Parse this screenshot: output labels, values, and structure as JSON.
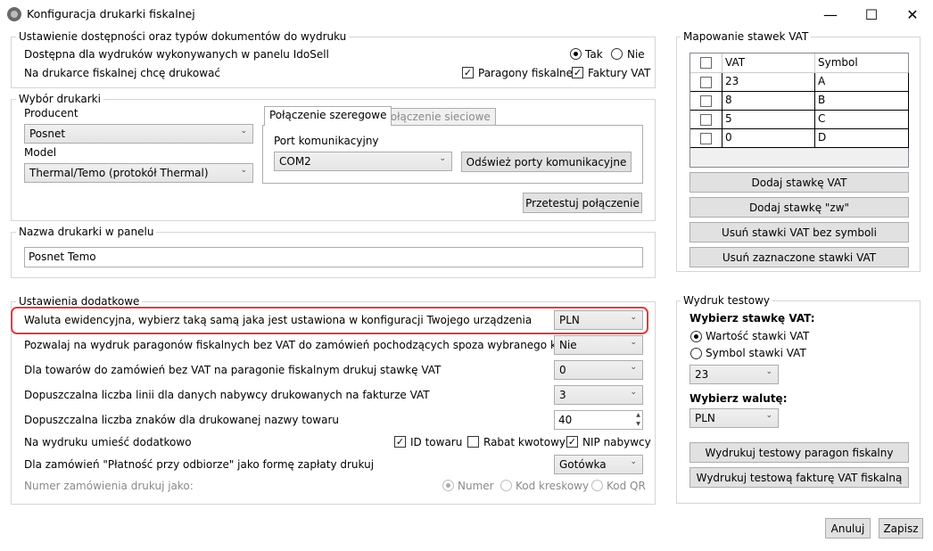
{
  "window": {
    "title": "Konfiguracja drukarki fiskalnej",
    "minimize": "—",
    "maximize": "☐",
    "close": "✕"
  },
  "availability": {
    "legend": "Ustawienie dostępności oraz typów dokumentów do wydruku",
    "available_label": "Dostępna dla wydruków wykonywanych w panelu IdoSell",
    "yes": "Tak",
    "no": "Nie",
    "print_label": "Na drukarce fiskalnej chcę drukować",
    "receipts": "Paragony fiskalne",
    "invoices": "Faktury VAT"
  },
  "printer": {
    "legend": "Wybór drukarki",
    "producer_label": "Producent",
    "producer_value": "Posnet",
    "model_label": "Model",
    "model_value": "Thermal/Temo (protokół Thermal)",
    "tab_serial": "Połączenie szeregowe",
    "tab_network": "Połączenie sieciowe",
    "port_label": "Port komunikacyjny",
    "port_value": "COM2",
    "refresh_ports": "Odśwież porty komunikacyjne",
    "test_connection": "Przetestuj połączenie"
  },
  "name_section": {
    "legend": "Nazwa drukarki w panelu",
    "value": "Posnet Temo"
  },
  "extra": {
    "legend": "Ustawienia dodatkowe",
    "currency_label": "Waluta ewidencyjna, wybierz taką samą jaka jest ustawiona w konfiguracji Twojego urządzenia",
    "currency_value": "PLN",
    "no_vat_label": "Pozwalaj na wydruk paragonów fiskalnych bez VAT do zamówień pochodzących spoza wybranego kraju",
    "no_vat_value": "Nie",
    "vat_rate_label": "Dla towarów do zamówień bez VAT na paragonie fiskalnym drukuj stawkę VAT",
    "vat_rate_value": "0",
    "lines_label": "Dopuszczalna liczba linii dla danych nabywcy drukowanych na fakturze VAT",
    "lines_value": "3",
    "chars_label": "Dopuszczalna liczba znaków dla drukowanej nazwy towaru",
    "chars_value": "40",
    "also_print_label": "Na wydruku umieść dodatkowo",
    "id_product": "ID towaru",
    "discount": "Rabat kwotowy",
    "nip": "NIP nabywcy",
    "cod_label": "Dla zamówień \"Płatność przy odbiorze\" jako formę zapłaty drukuj",
    "cod_value": "Gotówka",
    "order_number_label": "Numer zamówienia drukuj jako:",
    "num": "Numer",
    "barcode": "Kod kreskowy",
    "qr": "Kod QR"
  },
  "vat_mapping": {
    "legend": "Mapowanie stawek VAT",
    "col_vat": "VAT",
    "col_symbol": "Symbol",
    "rows": [
      {
        "vat": "23",
        "symbol": "A"
      },
      {
        "vat": "8",
        "symbol": "B"
      },
      {
        "vat": "5",
        "symbol": "C"
      },
      {
        "vat": "0",
        "symbol": "D"
      }
    ],
    "add_rate": "Dodaj stawkę VAT",
    "add_zw": "Dodaj stawkę \"zw\"",
    "remove_without_symbol": "Usuń stawki VAT bez symboli",
    "remove_selected": "Usuń zaznaczone stawki VAT"
  },
  "test_print": {
    "legend": "Wydruk testowy",
    "choose_rate": "Wybierz stawkę VAT:",
    "rate_value_opt": "Wartość stawki VAT",
    "rate_symbol_opt": "Symbol stawki VAT",
    "rate_select": "23",
    "choose_currency": "Wybierz walutę:",
    "currency_select": "PLN",
    "print_receipt": "Wydrukuj testowy paragon fiskalny",
    "print_invoice": "Wydrukuj testową fakturę VAT fiskalną"
  },
  "footer": {
    "cancel": "Anuluj",
    "save": "Zapisz"
  },
  "colors": {
    "highlight": "#e53a3a",
    "button_bg": "#e1e1e1",
    "group_border": "#d5d5d5"
  }
}
